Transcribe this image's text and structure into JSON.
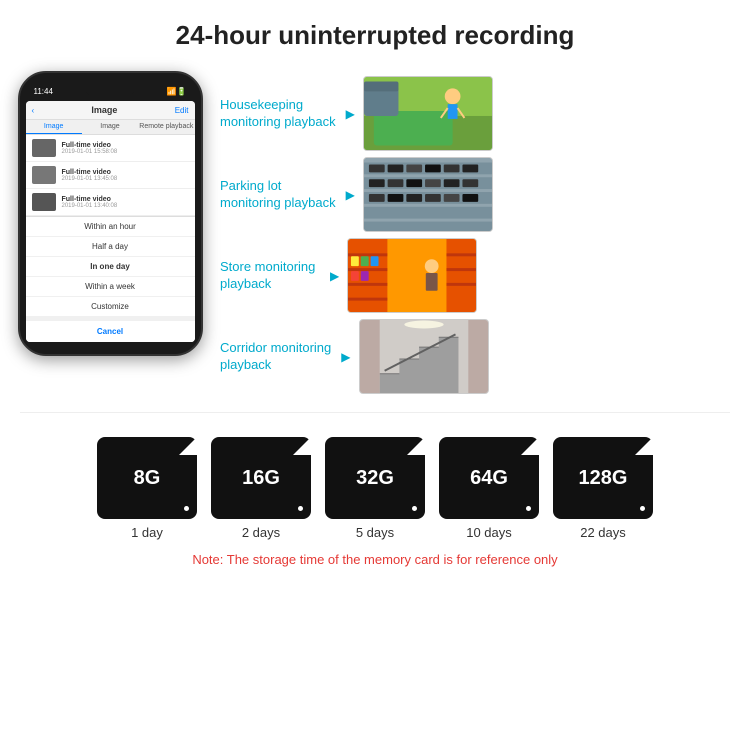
{
  "title": "24-hour uninterrupted recording",
  "phone": {
    "time": "11:44",
    "header_back": "<",
    "header_title": "Image",
    "header_edit": "Edit",
    "tabs": [
      "Image",
      "Image",
      "Remote playback"
    ],
    "list_items": [
      {
        "title": "Full-time video",
        "date": "2019-01-01 15:58:08"
      },
      {
        "title": "Full-time video",
        "date": "2019-01-01 13:45:08"
      },
      {
        "title": "Full-time video",
        "date": "2019-01-01 13:40:08"
      }
    ],
    "dropdown_items": [
      "Within an hour",
      "Half a day",
      "In one day",
      "Within a week",
      "Customize"
    ],
    "cancel_label": "Cancel"
  },
  "monitoring": [
    {
      "label": "Housekeeping\nmonitoring playback",
      "img_class": "img-house",
      "alt": "Child playing on floor mat"
    },
    {
      "label": "Parking lot\nmonitoring playback",
      "img_class": "img-parking",
      "alt": "Aerial view of parking lot"
    },
    {
      "label": "Store monitoring\nplayback",
      "img_class": "img-store",
      "alt": "Store interior"
    },
    {
      "label": "Corridor monitoring\nplayback",
      "img_class": "img-corridor",
      "alt": "Corridor staircase"
    }
  ],
  "sdcards": [
    {
      "size": "8G",
      "days": "1 day"
    },
    {
      "size": "16G",
      "days": "2 days"
    },
    {
      "size": "32G",
      "days": "5 days"
    },
    {
      "size": "64G",
      "days": "10 days"
    },
    {
      "size": "128G",
      "days": "22 days"
    }
  ],
  "note": "Note: The storage time of the memory card is for reference only"
}
